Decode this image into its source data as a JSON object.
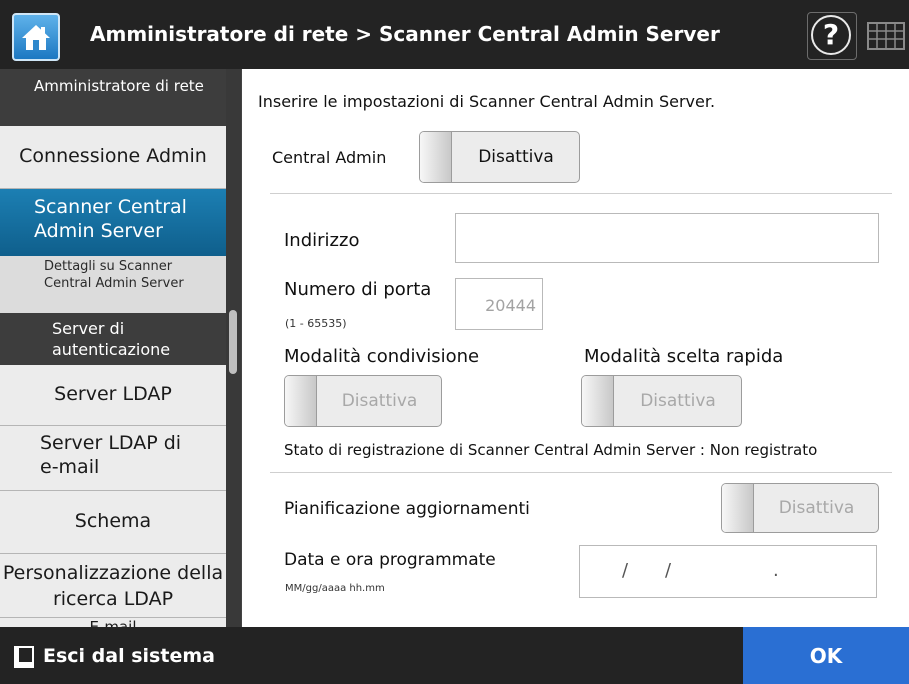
{
  "header": {
    "title": "Amministratore di rete > Scanner Central Admin Server",
    "home_icon": "home-icon",
    "help_label": "?",
    "help_icon": "help-icon",
    "keyboard_icon": "keyboard-icon"
  },
  "sidebar": {
    "category_top": "Amministratore di rete",
    "items": [
      {
        "label": "Connessione Admin"
      },
      {
        "label": "Scanner Central Admin Server",
        "active": true
      },
      {
        "label": "Dettagli su Scanner Central Admin Server"
      },
      {
        "label": "Server di autenticazione"
      },
      {
        "label": "Server LDAP"
      },
      {
        "label": "Server LDAP di e-mail"
      },
      {
        "label": "Schema"
      },
      {
        "label": "Personalizzazione della ricerca LDAP"
      },
      {
        "label": "E-mail"
      }
    ]
  },
  "main": {
    "intro": "Inserire le impostazioni di Scanner Central Admin Server.",
    "central_admin": {
      "label": "Central Admin",
      "value": "Disattiva"
    },
    "address": {
      "label": "Indirizzo",
      "value": ""
    },
    "port": {
      "label": "Numero di porta",
      "range": "(1 - 65535)",
      "value": "20444"
    },
    "sharing_mode": {
      "label": "Modalità condivisione",
      "value": "Disattiva"
    },
    "shortcut_mode": {
      "label": "Modalità scelta rapida",
      "value": "Disattiva"
    },
    "registration_status": "Stato di registrazione di Scanner Central Admin Server : Non registrato",
    "update_schedule": {
      "label": "Pianificazione aggiornamenti",
      "value": "Disattiva"
    },
    "scheduled_datetime": {
      "label": "Data e ora programmate",
      "format": "MM/gg/aaaa hh.mm",
      "sep1": "/",
      "sep2": "/",
      "sep3": "."
    }
  },
  "footer": {
    "logout_label": "Esci dal sistema",
    "logout_icon": "logout-icon",
    "ok_label": "OK"
  },
  "colors": {
    "header_bg": "#232323",
    "active_item": "#1a78aa",
    "ok_button": "#2a6fd3"
  }
}
